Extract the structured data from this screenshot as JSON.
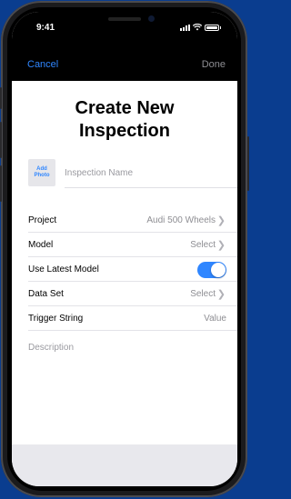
{
  "status_bar": {
    "time": "9:41"
  },
  "nav": {
    "cancel_label": "Cancel",
    "done_label": "Done"
  },
  "page": {
    "title_line1": "Create New",
    "title_line2": "Inspection"
  },
  "photo": {
    "label_line1": "Add",
    "label_line2": "Photo"
  },
  "name_field": {
    "placeholder": "Inspection Name"
  },
  "form": {
    "project": {
      "label": "Project",
      "value": "Audi 500 Wheels"
    },
    "model": {
      "label": "Model",
      "value": "Select"
    },
    "use_latest_model": {
      "label": "Use Latest Model",
      "on": true
    },
    "data_set": {
      "label": "Data Set",
      "value": "Select"
    },
    "trigger_string": {
      "label": "Trigger String",
      "value": "Value"
    }
  },
  "description": {
    "placeholder": "Description"
  },
  "colors": {
    "accent": "#2f86ff",
    "background": "#0a3d8f"
  }
}
